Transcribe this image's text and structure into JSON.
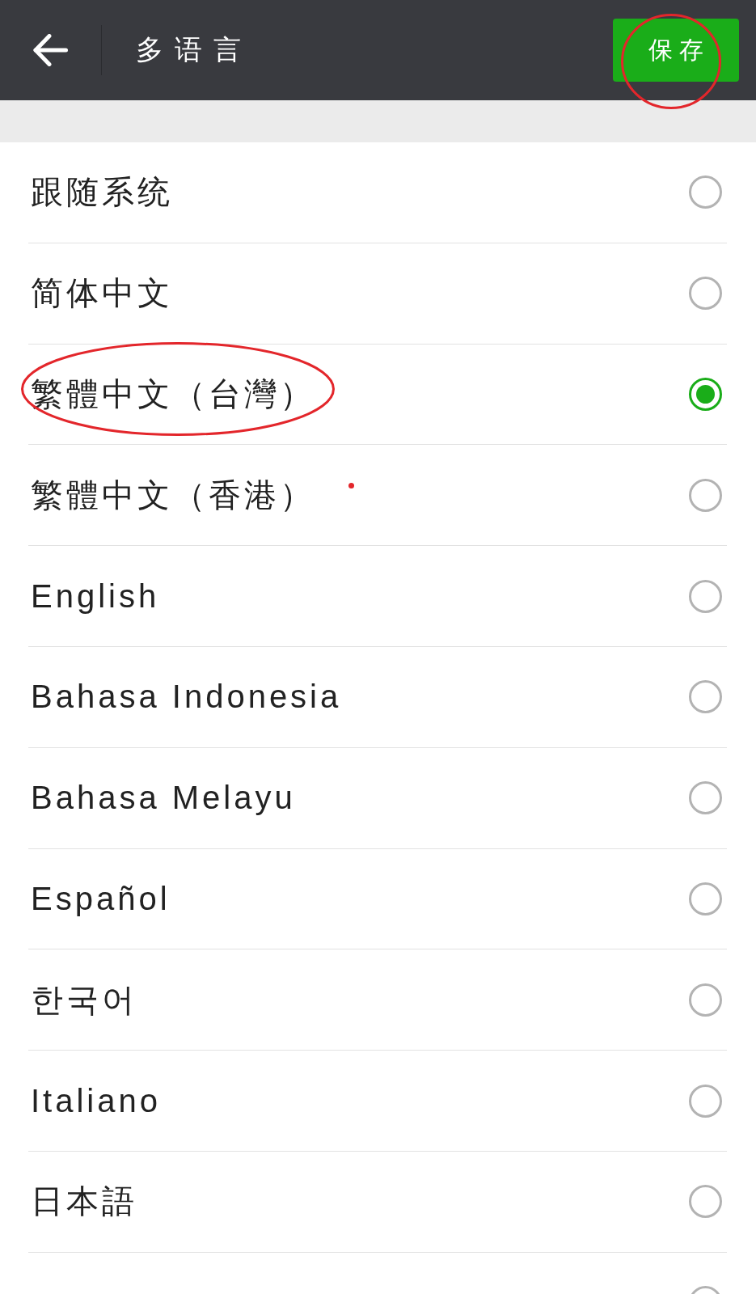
{
  "header": {
    "title": "多语言",
    "save_button": {
      "label": "保存",
      "circled": true
    }
  },
  "languages": [
    {
      "label": "跟随系统",
      "selected": false,
      "circled": false
    },
    {
      "label": "简体中文",
      "selected": false,
      "circled": false
    },
    {
      "label": "繁體中文（台灣）",
      "selected": true,
      "circled": true
    },
    {
      "label": "繁體中文（香港）",
      "selected": false,
      "circled": false
    },
    {
      "label": "English",
      "selected": false,
      "circled": false
    },
    {
      "label": "Bahasa Indonesia",
      "selected": false,
      "circled": false
    },
    {
      "label": "Bahasa Melayu",
      "selected": false,
      "circled": false
    },
    {
      "label": "Español",
      "selected": false,
      "circled": false
    },
    {
      "label": "한국어",
      "selected": false,
      "circled": false
    },
    {
      "label": "Italiano",
      "selected": false,
      "circled": false
    },
    {
      "label": "日本語",
      "selected": false,
      "circled": false
    },
    {
      "selected": false,
      "circled": false
    }
  ]
}
